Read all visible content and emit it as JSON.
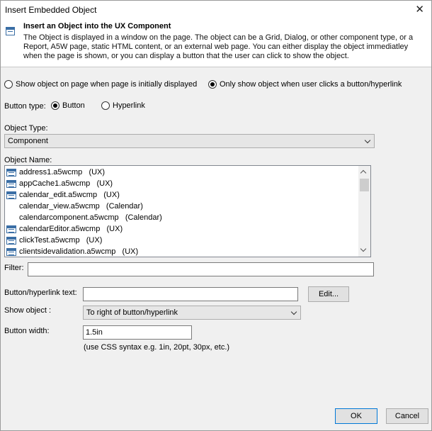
{
  "window": {
    "title": "Insert Embedded Object",
    "close_symbol": "✕"
  },
  "header": {
    "title": "Insert an Object into the UX Component",
    "description": "The Object is displayed in a window on the page. The object can be a Grid, Dialog, or other component type, or a Report, A5W page, static HTML content, or an external web page. You can either display the object immediatley when the page is shown, or you can display a button that the user can click to show the object."
  },
  "display_mode": {
    "options": [
      {
        "label": "Show object on page when page is initially displayed",
        "selected": false
      },
      {
        "label": "Only show object when user clicks a button/hyperlink",
        "selected": true
      }
    ]
  },
  "button_type": {
    "label": "Button type:",
    "options": [
      {
        "label": "Button",
        "selected": true
      },
      {
        "label": "Hyperlink",
        "selected": false
      }
    ]
  },
  "object_type": {
    "label": "Object Type:",
    "value": "Component"
  },
  "object_name": {
    "label": "Object Name:",
    "items": [
      {
        "name": "address1.a5wcmp",
        "type": "(UX)",
        "icon": "ux-component-icon"
      },
      {
        "name": "appCache1.a5wcmp",
        "type": "(UX)",
        "icon": "ux-component-icon"
      },
      {
        "name": "calendar_edit.a5wcmp",
        "type": "(UX)",
        "icon": "ux-component-icon"
      },
      {
        "name": "calendar_view.a5wcmp",
        "type": "(Calendar)",
        "icon": ""
      },
      {
        "name": "calendarcomponent.a5wcmp",
        "type": "(Calendar)",
        "icon": ""
      },
      {
        "name": "calendarEditor.a5wcmp",
        "type": "(UX)",
        "icon": "ux-component-icon"
      },
      {
        "name": "clickTest.a5wcmp",
        "type": "(UX)",
        "icon": "ux-component-icon"
      },
      {
        "name": "clientsidevalidation.a5wcmp",
        "type": "(UX)",
        "icon": "ux-component-icon"
      }
    ]
  },
  "filter": {
    "label": "Filter:",
    "value": ""
  },
  "button_text": {
    "label": "Button/hyperlink text:",
    "value": "",
    "edit_label": "Edit..."
  },
  "show_object": {
    "label": "Show object :",
    "value": "To right of button/hyperlink"
  },
  "button_width": {
    "label": "Button width:",
    "value": "1.5in",
    "hint": "(use CSS syntax e.g. 1in, 20pt, 30px, etc.)"
  },
  "footer": {
    "ok_label": "OK",
    "cancel_label": "Cancel"
  },
  "colors": {
    "accent": "#0078d7",
    "icon_blue": "#3a6ea5",
    "dialog_bg": "#f0f0f0"
  }
}
